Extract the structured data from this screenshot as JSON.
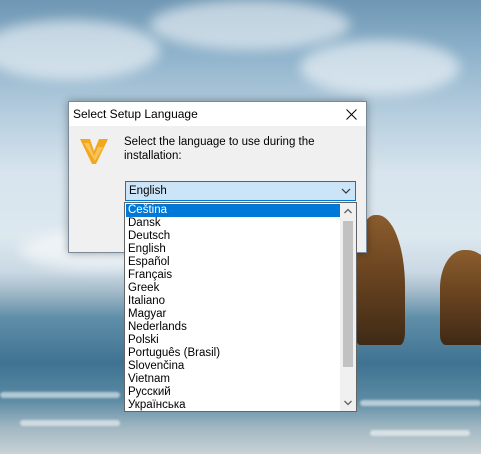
{
  "dialog": {
    "title": "Select Setup Language",
    "prompt": "Select the language to use during the installation:",
    "close_icon": "close-icon",
    "logo_icon": "app-logo-icon"
  },
  "combo": {
    "value": "English",
    "arrow_icon": "chevron-down-icon"
  },
  "dropdown": {
    "selected_index": 0,
    "options": [
      "Čeština",
      "Dansk",
      "Deutsch",
      "English",
      "Español",
      "Français",
      "Greek",
      "Italiano",
      "Magyar",
      "Nederlands",
      "Polski",
      "Português (Brasil)",
      "Slovenčina",
      "Vietnam",
      "Русский",
      "Українська"
    ],
    "scroll_up_icon": "scroll-up-icon",
    "scroll_down_icon": "scroll-down-icon"
  },
  "colors": {
    "highlight": "#0078d7",
    "combo_background": "#cce4f7",
    "logo": "#f3a71d"
  }
}
